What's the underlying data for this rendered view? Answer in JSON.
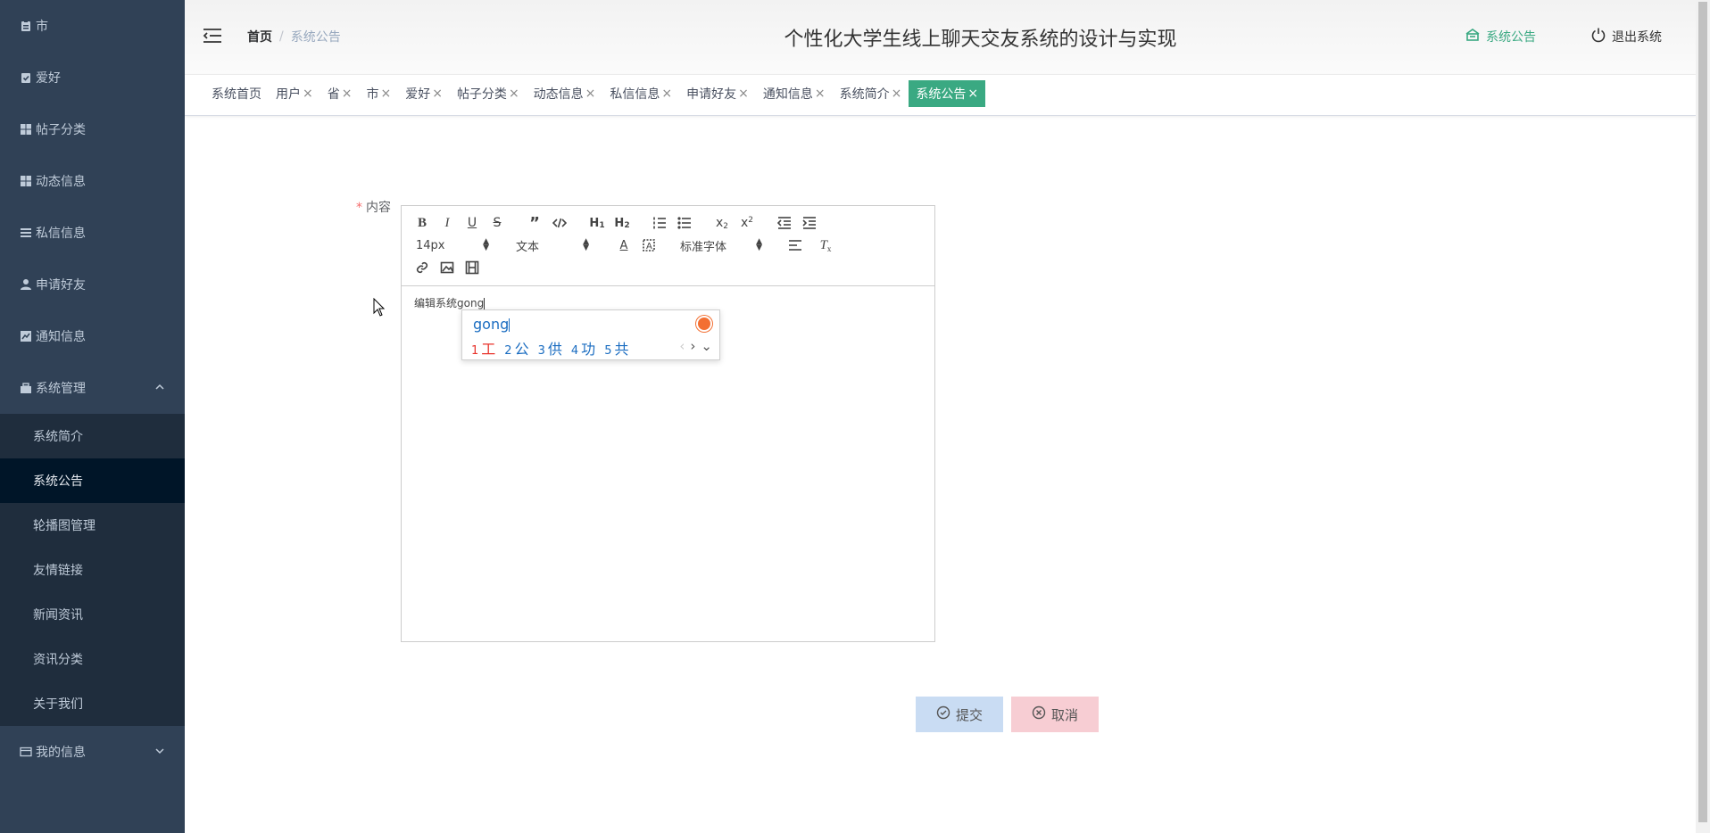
{
  "header": {
    "title": "个性化大学生线上聊天交友系统的设计与实现",
    "breadcrumb": {
      "home": "首页",
      "separator": "/",
      "current": "系统公告"
    },
    "notice_link": "系统公告",
    "logout_link": "退出系统"
  },
  "sidebar": {
    "items": [
      {
        "label": "市",
        "icon": "clipboard-icon"
      },
      {
        "label": "爱好",
        "icon": "clipboard-check-icon"
      },
      {
        "label": "帖子分类",
        "icon": "grid-icon"
      },
      {
        "label": "动态信息",
        "icon": "grid-icon"
      },
      {
        "label": "私信信息",
        "icon": "list-icon"
      },
      {
        "label": "申请好友",
        "icon": "user-icon"
      },
      {
        "label": "通知信息",
        "icon": "chart-icon"
      }
    ],
    "group_system": {
      "label": "系统管理",
      "icon": "briefcase-icon"
    },
    "sub_items": [
      {
        "label": "系统简介"
      },
      {
        "label": "系统公告"
      },
      {
        "label": "轮播图管理"
      },
      {
        "label": "友情链接"
      },
      {
        "label": "新闻资讯"
      },
      {
        "label": "资讯分类"
      },
      {
        "label": "关于我们"
      }
    ],
    "group_myinfo": {
      "label": "我的信息",
      "icon": "card-icon"
    }
  },
  "tags": [
    {
      "label": "系统首页",
      "closable": false
    },
    {
      "label": "用户",
      "closable": true
    },
    {
      "label": "省",
      "closable": true
    },
    {
      "label": "市",
      "closable": true
    },
    {
      "label": "爱好",
      "closable": true
    },
    {
      "label": "帖子分类",
      "closable": true
    },
    {
      "label": "动态信息",
      "closable": true
    },
    {
      "label": "私信信息",
      "closable": true
    },
    {
      "label": "申请好友",
      "closable": true
    },
    {
      "label": "通知信息",
      "closable": true
    },
    {
      "label": "系统简介",
      "closable": true
    },
    {
      "label": "系统公告",
      "closable": true,
      "active": true
    }
  ],
  "tag_close": "×",
  "form": {
    "content_label": "内容",
    "required_mark": "*",
    "editor": {
      "font_size": "14px",
      "header_select": "文本",
      "font_family": "标准字体",
      "text": "编辑系统gong"
    },
    "submit_label": "提交",
    "cancel_label": "取消"
  },
  "ime": {
    "input": "gong",
    "candidates": [
      {
        "num": "1",
        "text": "工"
      },
      {
        "num": "2",
        "text": "公"
      },
      {
        "num": "3",
        "text": "供"
      },
      {
        "num": "4",
        "text": "功"
      },
      {
        "num": "5",
        "text": "共"
      }
    ],
    "prev": "‹",
    "next": "›",
    "expand": "⌄"
  },
  "colors": {
    "sidebar_bg": "#304156",
    "submenu_bg": "#1f2d3d",
    "active_submenu_bg": "#001528",
    "accent": "#3aa982"
  }
}
